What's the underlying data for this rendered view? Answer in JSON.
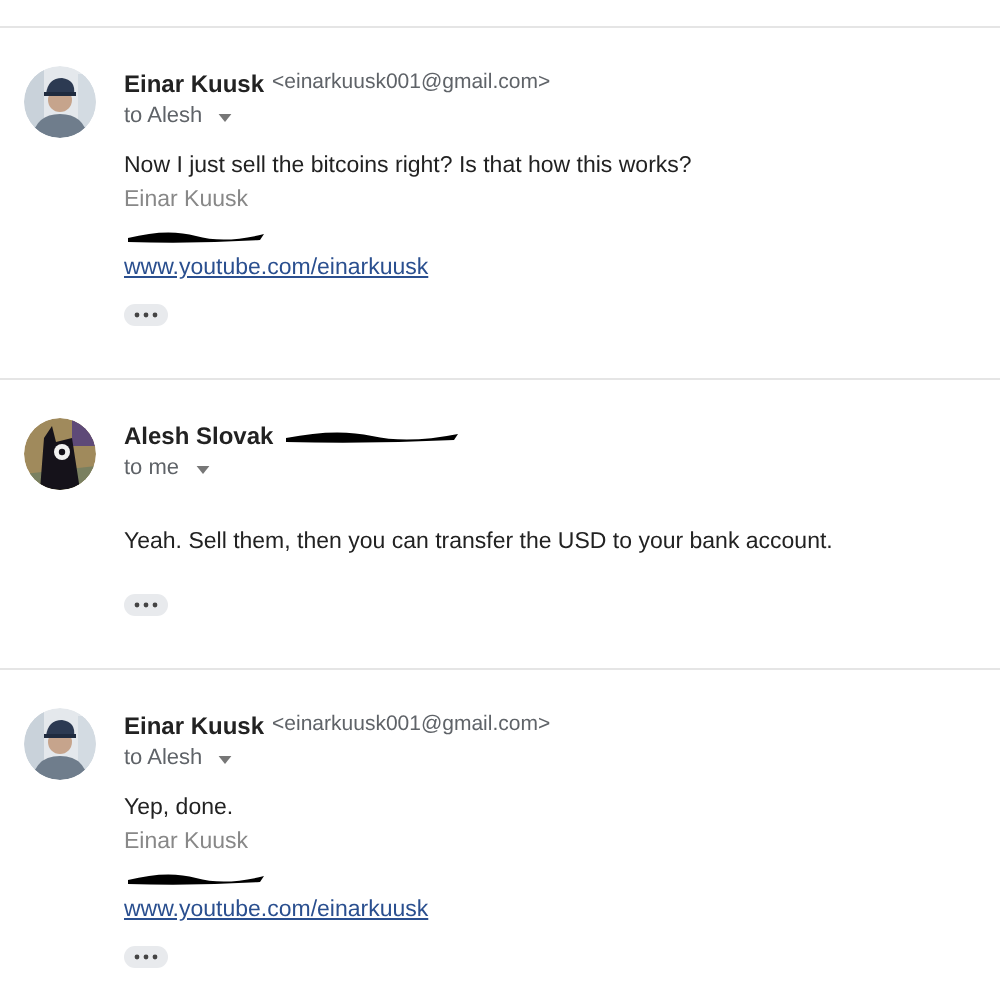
{
  "messages": [
    {
      "sender": "Einar Kuusk",
      "email": "<einarkuusk001@gmail.com>",
      "email_redacted": false,
      "recipient": "to Alesh",
      "body": "Now I just sell the bitcoins right? Is that how this works?",
      "signature": {
        "name": "Einar Kuusk",
        "phone_redacted": true,
        "link": "www.youtube.com/einarkuusk"
      }
    },
    {
      "sender": "Alesh Slovak",
      "email_redacted": true,
      "recipient": "to me",
      "body": "Yeah. Sell them, then you can transfer the USD to your bank account."
    },
    {
      "sender": "Einar Kuusk",
      "email": "<einarkuusk001@gmail.com>",
      "email_redacted": false,
      "recipient": "to Alesh",
      "body": "Yep, done.",
      "signature": {
        "name": "Einar Kuusk",
        "phone_redacted": true,
        "link": "www.youtube.com/einarkuusk"
      }
    }
  ]
}
